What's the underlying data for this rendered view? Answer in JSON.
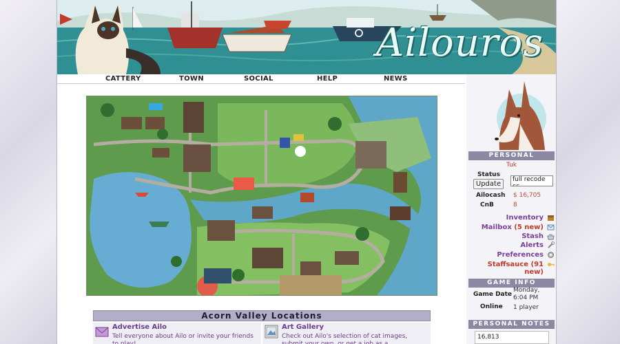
{
  "banner": {
    "title": "Ailouros"
  },
  "nav": {
    "items": [
      "CATTERY",
      "TOWN",
      "SOCIAL",
      "HELP",
      "NEWS"
    ]
  },
  "locations": {
    "heading": "Acorn Valley Locations",
    "items": [
      {
        "title": "Advertise Ailo",
        "desc": "Tell everyone about Ailo or invite your friends to play!"
      },
      {
        "title": "Art Gallery",
        "desc": "Check out Ailo's selection of cat images, submit your own, or get a job as a photographer."
      }
    ]
  },
  "sidebar": {
    "personal_heading": "PERSONAL",
    "username": "Tuk",
    "status_label": "Status",
    "update_label": "Update",
    "status_value": "full recode cc",
    "ailocash_label": "Ailocash",
    "ailocash_value": "$ 16,705",
    "cnb_label": "CnB",
    "cnb_value": "8",
    "links": [
      {
        "label": "Inventory",
        "icon": "chest-icon"
      },
      {
        "label": "Mailbox",
        "extra": "(5 new)",
        "icon": "mail-icon"
      },
      {
        "label": "Stash",
        "icon": "stash-icon"
      },
      {
        "label": "Alerts",
        "icon": "wrench-icon"
      },
      {
        "label": "Preferences",
        "icon": "gear-icon"
      },
      {
        "label": "Staffsauce",
        "extra": "(91 new)",
        "icon": "key-icon"
      }
    ],
    "game_info_heading": "GAME INFO",
    "game_date_label": "Game Date",
    "game_date_value": "Monday, 6:04 PM",
    "online_label": "Online",
    "online_value": "1 player",
    "notes_heading": "PERSONAL NOTES",
    "notes_value": "16,813"
  },
  "colors": {
    "accent": "#7a3f98",
    "header_bar": "#8c88a3",
    "alert_red": "#c0392b"
  }
}
